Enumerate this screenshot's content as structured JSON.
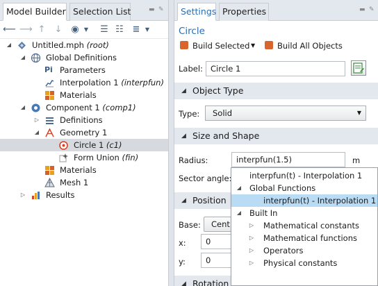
{
  "left_pane": {
    "tabs": [
      {
        "label": "Model Builder"
      },
      {
        "label": "Selection List"
      }
    ],
    "tree": [
      {
        "label": "Untitled.mph",
        "tag": "(root)"
      },
      {
        "label": "Global Definitions",
        "tag": ""
      },
      {
        "label": "Parameters",
        "tag": ""
      },
      {
        "label": "Interpolation 1",
        "tag": "(interpfun)"
      },
      {
        "label": "Materials",
        "tag": ""
      },
      {
        "label": "Component 1",
        "tag": "(comp1)"
      },
      {
        "label": "Definitions",
        "tag": ""
      },
      {
        "label": "Geometry 1",
        "tag": ""
      },
      {
        "label": "Circle 1",
        "tag": "(c1)"
      },
      {
        "label": "Form Union",
        "tag": "(fin)"
      },
      {
        "label": "Materials",
        "tag": ""
      },
      {
        "label": "Mesh 1",
        "tag": ""
      },
      {
        "label": "Results",
        "tag": ""
      }
    ]
  },
  "right_pane": {
    "tabs": [
      {
        "label": "Settings"
      },
      {
        "label": "Properties"
      }
    ],
    "title": "Circle",
    "build_selected": "Build Selected",
    "build_all": "Build All Objects",
    "label_field": {
      "label": "Label:",
      "value": "Circle 1"
    },
    "sections": {
      "object_type": "Object Type",
      "size_and_shape": "Size and Shape",
      "position": "Position",
      "rotation": "Rotation"
    },
    "type_field": {
      "label": "Type:",
      "value": "Solid"
    },
    "radius_field": {
      "label": "Radius:",
      "value": "interpfun(1.5)",
      "unit": "m"
    },
    "sector_angle_label": "Sector angle:",
    "base_field": {
      "label": "Base:",
      "value": "Cent"
    },
    "x_field": {
      "label": "x:",
      "value": "0"
    },
    "y_field": {
      "label": "y:",
      "value": "0"
    }
  },
  "popup": {
    "items": [
      {
        "label": "interpfun(t) - Interpolation 1"
      },
      {
        "label": "Global Functions"
      },
      {
        "label": "interpfun(t) - Interpolation 1"
      },
      {
        "label": "Built In"
      },
      {
        "label": "Mathematical constants"
      },
      {
        "label": "Mathematical functions"
      },
      {
        "label": "Operators"
      },
      {
        "label": "Physical constants"
      }
    ]
  },
  "colors": {
    "accent_blue": "#2b6db3",
    "selection_highlight": "#b9dbf3",
    "tree_selected": "#d6d9dd",
    "section_header_bg": "#e3e8ee"
  }
}
